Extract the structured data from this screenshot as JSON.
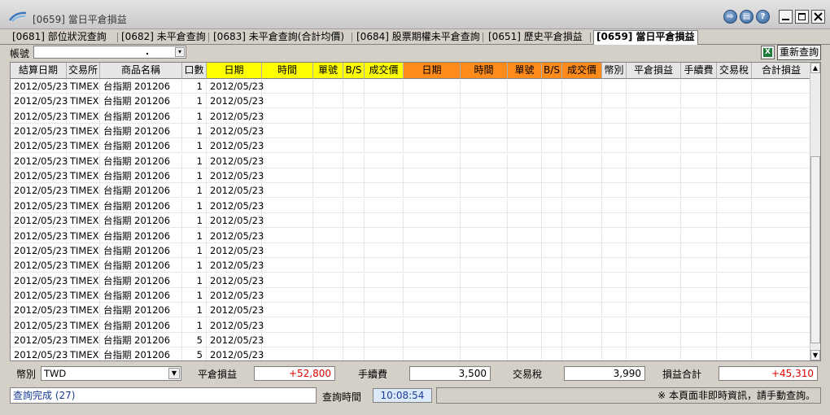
{
  "window": {
    "title": "[0659] 當日平倉損益"
  },
  "tabs": [
    {
      "label": "[0681] 部位狀況查詢",
      "active": false
    },
    {
      "label": "[0682] 未平倉查詢",
      "active": false
    },
    {
      "label": "[0683] 未平倉查詢(合計均價)",
      "active": false
    },
    {
      "label": "[0684] 股票期權未平倉查詢",
      "active": false
    },
    {
      "label": "[0651] 歷史平倉損益",
      "active": false
    },
    {
      "label": "[0659] 當日平倉損益",
      "active": true
    }
  ],
  "toolbar": {
    "account_label": "帳號",
    "account_value": "",
    "excel_icon": "excel-icon",
    "requery_label": "重新查詢"
  },
  "grid": {
    "headers": [
      {
        "label": "結算日期",
        "style": "plain"
      },
      {
        "label": "交易所",
        "style": "plain"
      },
      {
        "label": "商品名稱",
        "style": "plain"
      },
      {
        "label": "口數",
        "style": "plain"
      },
      {
        "label": "日期",
        "style": "open"
      },
      {
        "label": "時間",
        "style": "open"
      },
      {
        "label": "單號",
        "style": "open"
      },
      {
        "label": "B/S",
        "style": "open"
      },
      {
        "label": "成交價",
        "style": "open"
      },
      {
        "label": "日期",
        "style": "close"
      },
      {
        "label": "時間",
        "style": "close"
      },
      {
        "label": "單號",
        "style": "close"
      },
      {
        "label": "B/S",
        "style": "close"
      },
      {
        "label": "成交價",
        "style": "close"
      },
      {
        "label": "幣別",
        "style": "plain"
      },
      {
        "label": "平倉損益",
        "style": "plain"
      },
      {
        "label": "手續費",
        "style": "plain"
      },
      {
        "label": "交易稅",
        "style": "plain"
      },
      {
        "label": "合計損益",
        "style": "plain"
      }
    ],
    "rows": [
      {
        "settle_date": "2012/05/23",
        "exchange": "TIMEX",
        "product": "台指期 201206",
        "qty": "1",
        "open_date": "2012/05/23"
      },
      {
        "settle_date": "2012/05/23",
        "exchange": "TIMEX",
        "product": "台指期 201206",
        "qty": "1",
        "open_date": "2012/05/23"
      },
      {
        "settle_date": "2012/05/23",
        "exchange": "TIMEX",
        "product": "台指期 201206",
        "qty": "1",
        "open_date": "2012/05/23"
      },
      {
        "settle_date": "2012/05/23",
        "exchange": "TIMEX",
        "product": "台指期 201206",
        "qty": "1",
        "open_date": "2012/05/23"
      },
      {
        "settle_date": "2012/05/23",
        "exchange": "TIMEX",
        "product": "台指期 201206",
        "qty": "1",
        "open_date": "2012/05/23"
      },
      {
        "settle_date": "2012/05/23",
        "exchange": "TIMEX",
        "product": "台指期 201206",
        "qty": "1",
        "open_date": "2012/05/23"
      },
      {
        "settle_date": "2012/05/23",
        "exchange": "TIMEX",
        "product": "台指期 201206",
        "qty": "1",
        "open_date": "2012/05/23"
      },
      {
        "settle_date": "2012/05/23",
        "exchange": "TIMEX",
        "product": "台指期 201206",
        "qty": "1",
        "open_date": "2012/05/23"
      },
      {
        "settle_date": "2012/05/23",
        "exchange": "TIMEX",
        "product": "台指期 201206",
        "qty": "1",
        "open_date": "2012/05/23"
      },
      {
        "settle_date": "2012/05/23",
        "exchange": "TIMEX",
        "product": "台指期 201206",
        "qty": "1",
        "open_date": "2012/05/23"
      },
      {
        "settle_date": "2012/05/23",
        "exchange": "TIMEX",
        "product": "台指期 201206",
        "qty": "1",
        "open_date": "2012/05/23"
      },
      {
        "settle_date": "2012/05/23",
        "exchange": "TIMEX",
        "product": "台指期 201206",
        "qty": "1",
        "open_date": "2012/05/23"
      },
      {
        "settle_date": "2012/05/23",
        "exchange": "TIMEX",
        "product": "台指期 201206",
        "qty": "1",
        "open_date": "2012/05/23"
      },
      {
        "settle_date": "2012/05/23",
        "exchange": "TIMEX",
        "product": "台指期 201206",
        "qty": "1",
        "open_date": "2012/05/23"
      },
      {
        "settle_date": "2012/05/23",
        "exchange": "TIMEX",
        "product": "台指期 201206",
        "qty": "1",
        "open_date": "2012/05/23"
      },
      {
        "settle_date": "2012/05/23",
        "exchange": "TIMEX",
        "product": "台指期 201206",
        "qty": "1",
        "open_date": "2012/05/23"
      },
      {
        "settle_date": "2012/05/23",
        "exchange": "TIMEX",
        "product": "台指期 201206",
        "qty": "1",
        "open_date": "2012/05/23"
      },
      {
        "settle_date": "2012/05/23",
        "exchange": "TIMEX",
        "product": "台指期 201206",
        "qty": "5",
        "open_date": "2012/05/23"
      },
      {
        "settle_date": "2012/05/23",
        "exchange": "TIMEX",
        "product": "台指期 201206",
        "qty": "5",
        "open_date": "2012/05/23"
      },
      {
        "settle_date": "2012/05/23",
        "exchange": "TIMEX",
        "product": "台指期 201206",
        "qty": "1",
        "open_date": "2012/05/23"
      }
    ]
  },
  "summary": {
    "currency_label": "幣別",
    "currency_value": "TWD",
    "close_pl_label": "平倉損益",
    "close_pl_value": "+52,800",
    "fee_label": "手續費",
    "fee_value": "3,500",
    "tax_label": "交易稅",
    "tax_value": "3,990",
    "total_label": "損益合計",
    "total_value": "+45,310"
  },
  "status": {
    "message": "查詢完成 (27)",
    "query_time_label": "查詢時間",
    "query_time_value": "10:08:54",
    "notice": "※ 本頁面非即時資訊，請手動查詢。"
  },
  "colors": {
    "open_header": "#ffff00",
    "close_header": "#ff8c1a",
    "positive_value": "#e00000",
    "status_text": "#1a3c9a"
  }
}
